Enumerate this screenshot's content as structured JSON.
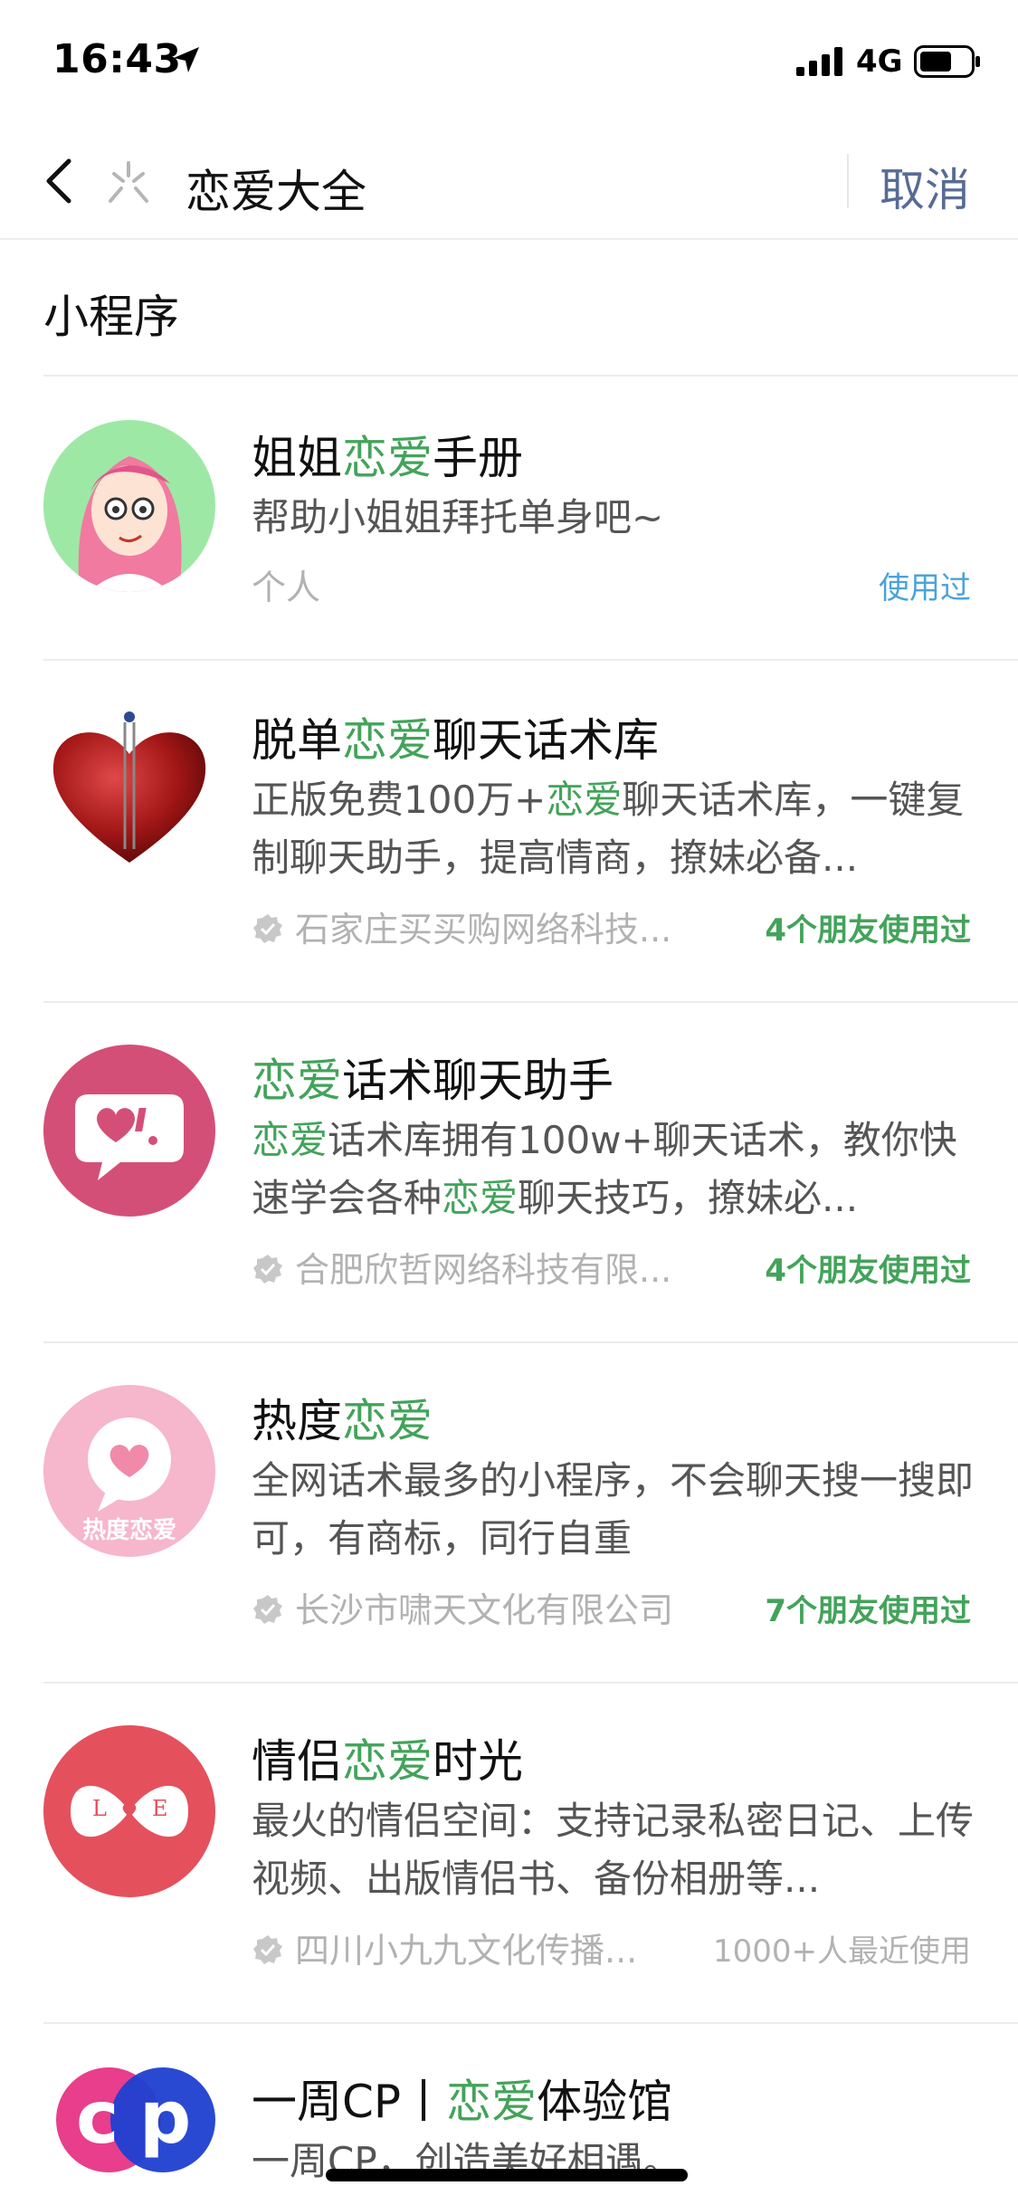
{
  "status_bar": {
    "time": "16:43",
    "network": "4G"
  },
  "search": {
    "query": "恋爱大全",
    "cancel_label": "取消"
  },
  "section": {
    "title": "小程序"
  },
  "items": [
    {
      "title_pre": "姐姐",
      "title_hl": "恋爱",
      "title_post": "手册",
      "desc": "帮助小姐姐拜托单身吧~",
      "meta": "个人",
      "meta_verified": false,
      "right": "使用过"
    },
    {
      "title_pre": "脱单",
      "title_hl": "恋爱",
      "title_post": "聊天话术库",
      "desc_parts": [
        "正版免费100万+",
        "恋爱",
        "聊天话术库，一键复制聊天助手，提高情商，撩妹必备..."
      ],
      "meta": "石家庄买买购网络科技...",
      "meta_verified": true,
      "right": "4个朋友使用过"
    },
    {
      "title_pre": "",
      "title_hl": "恋爱",
      "title_post": "话术聊天助手",
      "desc_parts": [
        "恋爱",
        "话术库拥有100w+聊天话术，教你快速学会各种",
        "恋爱",
        "聊天技巧，撩妹必..."
      ],
      "meta": "合肥欣哲网络科技有限...",
      "meta_verified": true,
      "right": "4个朋友使用过"
    },
    {
      "title_pre": "热度",
      "title_hl": "恋爱",
      "title_post": "",
      "desc": "全网话术最多的小程序，不会聊天搜一搜即可，有商标，同行自重",
      "meta": "长沙市啸天文化有限公司",
      "meta_verified": true,
      "right": "7个朋友使用过",
      "logo_text": "热度恋爱"
    },
    {
      "title_pre": "情侣",
      "title_hl": "恋爱",
      "title_post": "时光",
      "desc": "最火的情侣空间：支持记录私密日记、上传视频、出版情侣书、备份相册等...",
      "meta": "四川小九九文化传播...",
      "meta_verified": true,
      "right": "1000+人最近使用",
      "logo_letters": [
        "L",
        "E"
      ]
    },
    {
      "title_pre": "一周CP丨",
      "title_hl": "恋爱",
      "title_post": "体验馆",
      "desc": "一周CP，创造美好相遇。",
      "logo_letters": [
        "c",
        "p"
      ]
    }
  ],
  "colors": {
    "highlight": "#43a35a",
    "cancel": "#576b95",
    "used_blue": "#4aa3d8"
  }
}
